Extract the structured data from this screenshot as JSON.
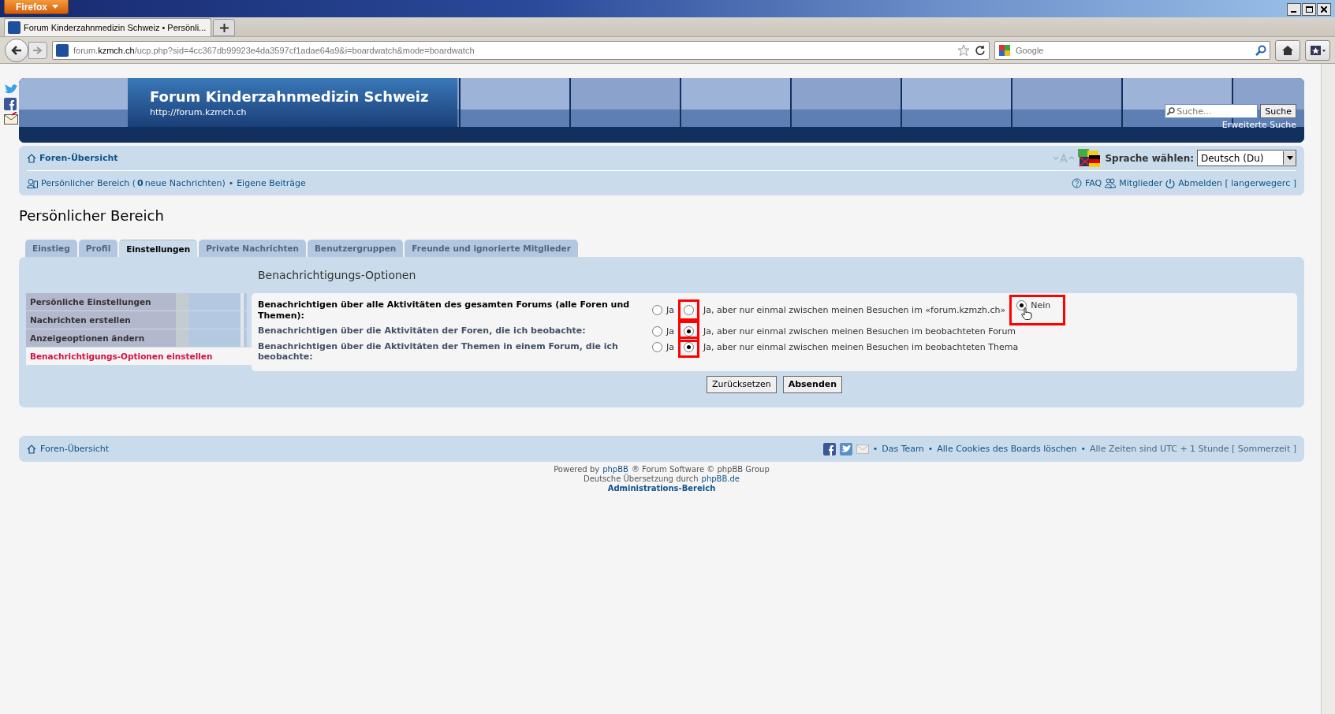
{
  "browser": {
    "app_button": "Firefox",
    "tab_title": "Forum Kinderzahnmedizin Schweiz • Persönli...",
    "url": [
      {
        "text": "forum.",
        "strong": false
      },
      {
        "text": "kzmch.ch",
        "strong": true
      },
      {
        "text": "/ucp.php?sid=4cc367db99923e4da3597cf1adae64a9&i=boardwatch&mode=boardwatch",
        "strong": false
      }
    ],
    "search_placeholder": "Google"
  },
  "header": {
    "title": "Forum Kinderzahnmedizin Schweiz",
    "subtitle": "http://forum.kzmch.ch",
    "search_placeholder": "Suche...",
    "search_button": "Suche",
    "advanced_search": "Erweiterte Suche"
  },
  "navbar": {
    "home": "Foren-Übersicht",
    "language_label": "Sprache wählen:",
    "language": "Deutsch (Du)",
    "user_link": "Persönlicher Bereich (**0** neue Nachrichten)",
    "separator": "•",
    "own_posts": "Eigene Beiträge",
    "right_links": [
      {
        "kind": "faq",
        "text": "FAQ"
      },
      {
        "kind": "members",
        "text": "Mitglieder"
      },
      {
        "kind": "logout",
        "text": "Abmelden [ langerwegerc ]"
      }
    ]
  },
  "page_title": "Persönlicher Bereich",
  "tabs": [
    {
      "label": "Einstieg",
      "selected": false
    },
    {
      "label": "Profil",
      "selected": false
    },
    {
      "label": "Einstellungen",
      "selected": true
    },
    {
      "label": "Private Nachrichten",
      "selected": false
    },
    {
      "label": "Benutzergruppen",
      "selected": false
    },
    {
      "label": "Freunde und ignorierte Mitglieder",
      "selected": false
    }
  ],
  "side_menu": [
    {
      "label": "Persönliche Einstellungen",
      "selected": false
    },
    {
      "label": "Nachrichten erstellen",
      "selected": false
    },
    {
      "label": "Anzeigeoptionen ändern",
      "selected": false
    },
    {
      "label": "Benachrichtigungs-Optionen einstellen",
      "selected": true
    }
  ],
  "form": {
    "title": "Benachrichtigungs-Optionen",
    "rows": [
      {
        "label": "Benachrichtigen über alle Aktivitäten des gesamten Forums (alle Foren und Themen):",
        "emphasis": true,
        "options": [
          {
            "label": "Ja",
            "checked": false,
            "highlighted": false
          },
          {
            "label": "Ja, aber nur einmal zwischen meinen Besuchen im «forum.kzmzh.ch»",
            "checked": false,
            "highlighted": true
          },
          {
            "label": "Nein",
            "checked": true,
            "highlighted": true
          }
        ]
      },
      {
        "label": "Benachrichtigen über die Aktivitäten der Foren, die ich beobachte:",
        "emphasis": false,
        "options": [
          {
            "label": "Ja",
            "checked": false,
            "highlighted": false
          },
          {
            "label": "Ja, aber nur einmal zwischen meinen Besuchen im beobachteten Forum",
            "checked": true,
            "highlighted": true
          }
        ]
      },
      {
        "label": "Benachrichtigen über die Aktivitäten der Themen in einem Forum, die ich beobachte:",
        "emphasis": false,
        "options": [
          {
            "label": "Ja",
            "checked": false,
            "highlighted": false
          },
          {
            "label": "Ja, aber nur einmal zwischen meinen Besuchen im beobachteten Thema",
            "checked": true,
            "highlighted": true
          }
        ]
      }
    ],
    "buttons": [
      {
        "label": "Zurücksetzen",
        "kind": "reset"
      },
      {
        "label": "Absenden",
        "kind": "submit"
      }
    ]
  },
  "footer": {
    "home": "Foren-Übersicht",
    "links": [
      {
        "text": "•",
        "kind": "separator"
      },
      {
        "text": "Das Team",
        "kind": "link"
      },
      {
        "text": "•",
        "kind": "separator"
      },
      {
        "text": "Alle Cookies des Boards löschen",
        "kind": "link"
      },
      {
        "text": "•",
        "kind": "separator"
      },
      {
        "text": "Alle Zeiten sind UTC + 1 Stunde [ Sommerzeit ]",
        "kind": "text"
      }
    ]
  },
  "copyright": [
    [
      {
        "text": "Powered by",
        "link": false
      },
      {
        "text": "phpBB",
        "link": true
      },
      {
        "text": "® Forum Software © phpBB Group",
        "link": false
      }
    ],
    [
      {
        "text": "Deutsche Übersetzung durch",
        "link": false
      },
      {
        "text": "phpBB.de",
        "link": true
      }
    ],
    [
      {
        "text": "Administrations-Bereich",
        "link": true
      }
    ]
  ]
}
